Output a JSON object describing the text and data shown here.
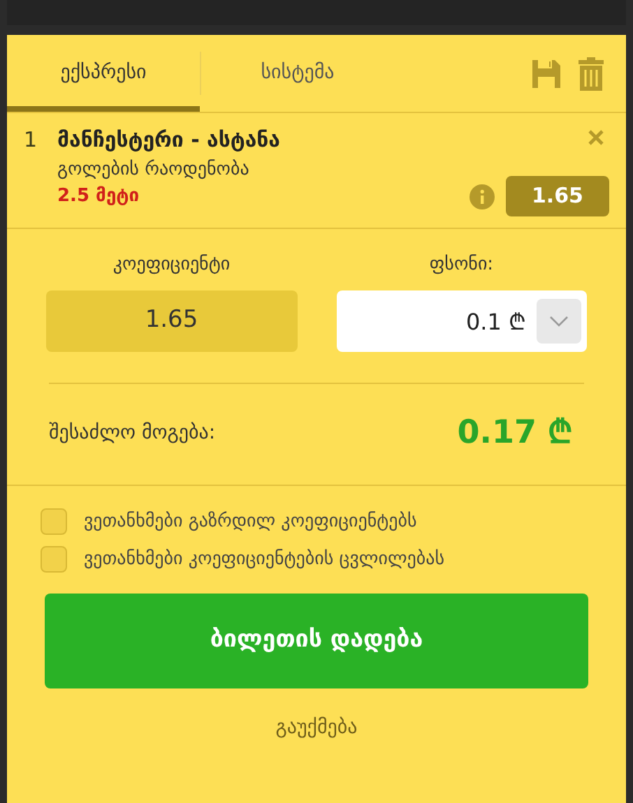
{
  "tabs": [
    {
      "label": "ექსპრესი",
      "selected": true
    },
    {
      "label": "სისტემა",
      "selected": false
    }
  ],
  "bet": {
    "number": "1",
    "match": "მანჩესტერი - ასტანა",
    "market": "გოლების რაოდენობა",
    "outcome": "2.5 მეტი",
    "odds": "1.65"
  },
  "odds_field": {
    "label": "კოეფიციენტი",
    "value": "1.65"
  },
  "stake_field": {
    "label": "ფსონი:",
    "value": "0.1 ₾"
  },
  "possible_win": {
    "label": "შესაძლო მოგება:",
    "value": "0.17 ₾"
  },
  "options": [
    {
      "label": "ვეთანხმები გაზრდილ კოეფიციენტებს",
      "checked": false
    },
    {
      "label": "ვეთანხმები კოეფიციენტების ცვლილებას",
      "checked": false
    }
  ],
  "place_button": "ბილეთის დადება",
  "cancel": "გაუქმება"
}
